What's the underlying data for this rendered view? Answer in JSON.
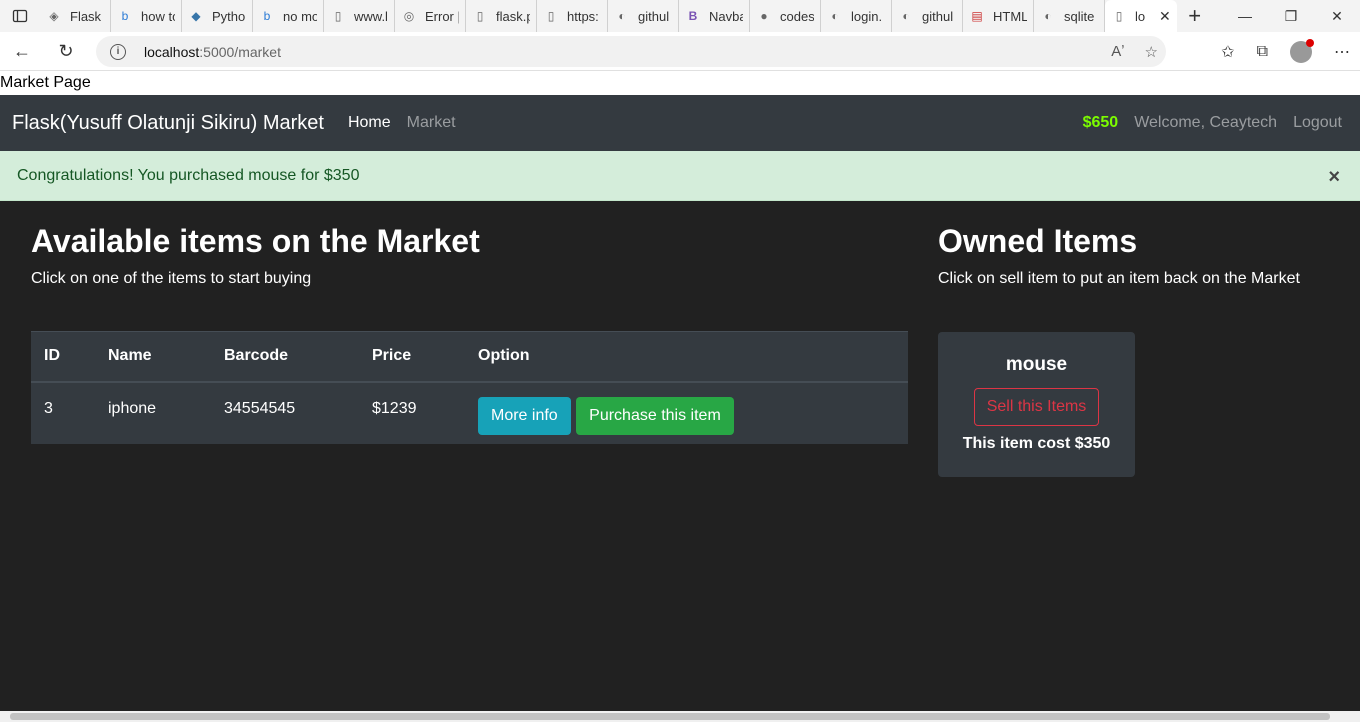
{
  "browser": {
    "tabs": [
      {
        "title": "Flask a",
        "icon": "diamond-icon"
      },
      {
        "title": "how to",
        "icon": "bing-icon"
      },
      {
        "title": "Pytho",
        "icon": "python-icon"
      },
      {
        "title": "no mo",
        "icon": "bing-icon"
      },
      {
        "title": "www.l",
        "icon": "page-icon"
      },
      {
        "title": "Error |",
        "icon": "circle-icon"
      },
      {
        "title": "flask.p",
        "icon": "page-icon"
      },
      {
        "title": "https:",
        "icon": "page-icon"
      },
      {
        "title": "githul",
        "icon": "github-doc-icon"
      },
      {
        "title": "Navba",
        "icon": "bootstrap-icon"
      },
      {
        "title": "codes",
        "icon": "github-icon"
      },
      {
        "title": "login.",
        "icon": "github-doc-icon"
      },
      {
        "title": "githul",
        "icon": "github-doc-icon"
      },
      {
        "title": "HTML",
        "icon": "pdf-icon"
      },
      {
        "title": "sqlite",
        "icon": "github-doc-icon"
      }
    ],
    "active_tab": {
      "title": "lo",
      "icon": "page-icon"
    },
    "url_host": "localhost",
    "url_path": ":5000/market"
  },
  "page": {
    "heading": "Market Page",
    "brand": "Flask(Yusuff Olatunji Sikiru) Market",
    "nav": {
      "home": "Home",
      "market": "Market"
    },
    "budget": "$650",
    "welcome": "Welcome, Ceaytech",
    "logout": "Logout",
    "alert": "Congratulations! You purchased mouse for $350",
    "alert_close": "×",
    "market": {
      "title": "Available items on the Market",
      "subtitle": "Click on one of the items to start buying",
      "columns": [
        "ID",
        "Name",
        "Barcode",
        "Price",
        "Option"
      ],
      "rows": [
        {
          "id": "3",
          "name": "iphone",
          "barcode": "34554545",
          "price": "$1239",
          "info_label": "More info",
          "buy_label": "Purchase this item"
        }
      ]
    },
    "owned": {
      "title": "Owned Items",
      "subtitle": "Click on sell item to put an item back on the Market",
      "items": [
        {
          "name": "mouse",
          "sell_label": "Sell this Items",
          "cost": "This item cost $350"
        }
      ]
    }
  },
  "colors": {
    "navbar": "#343a40",
    "budget": "#7cfc00",
    "alert_bg": "#d4edda",
    "info": "#17a2b8",
    "success": "#28a745",
    "danger": "#dc3545"
  }
}
